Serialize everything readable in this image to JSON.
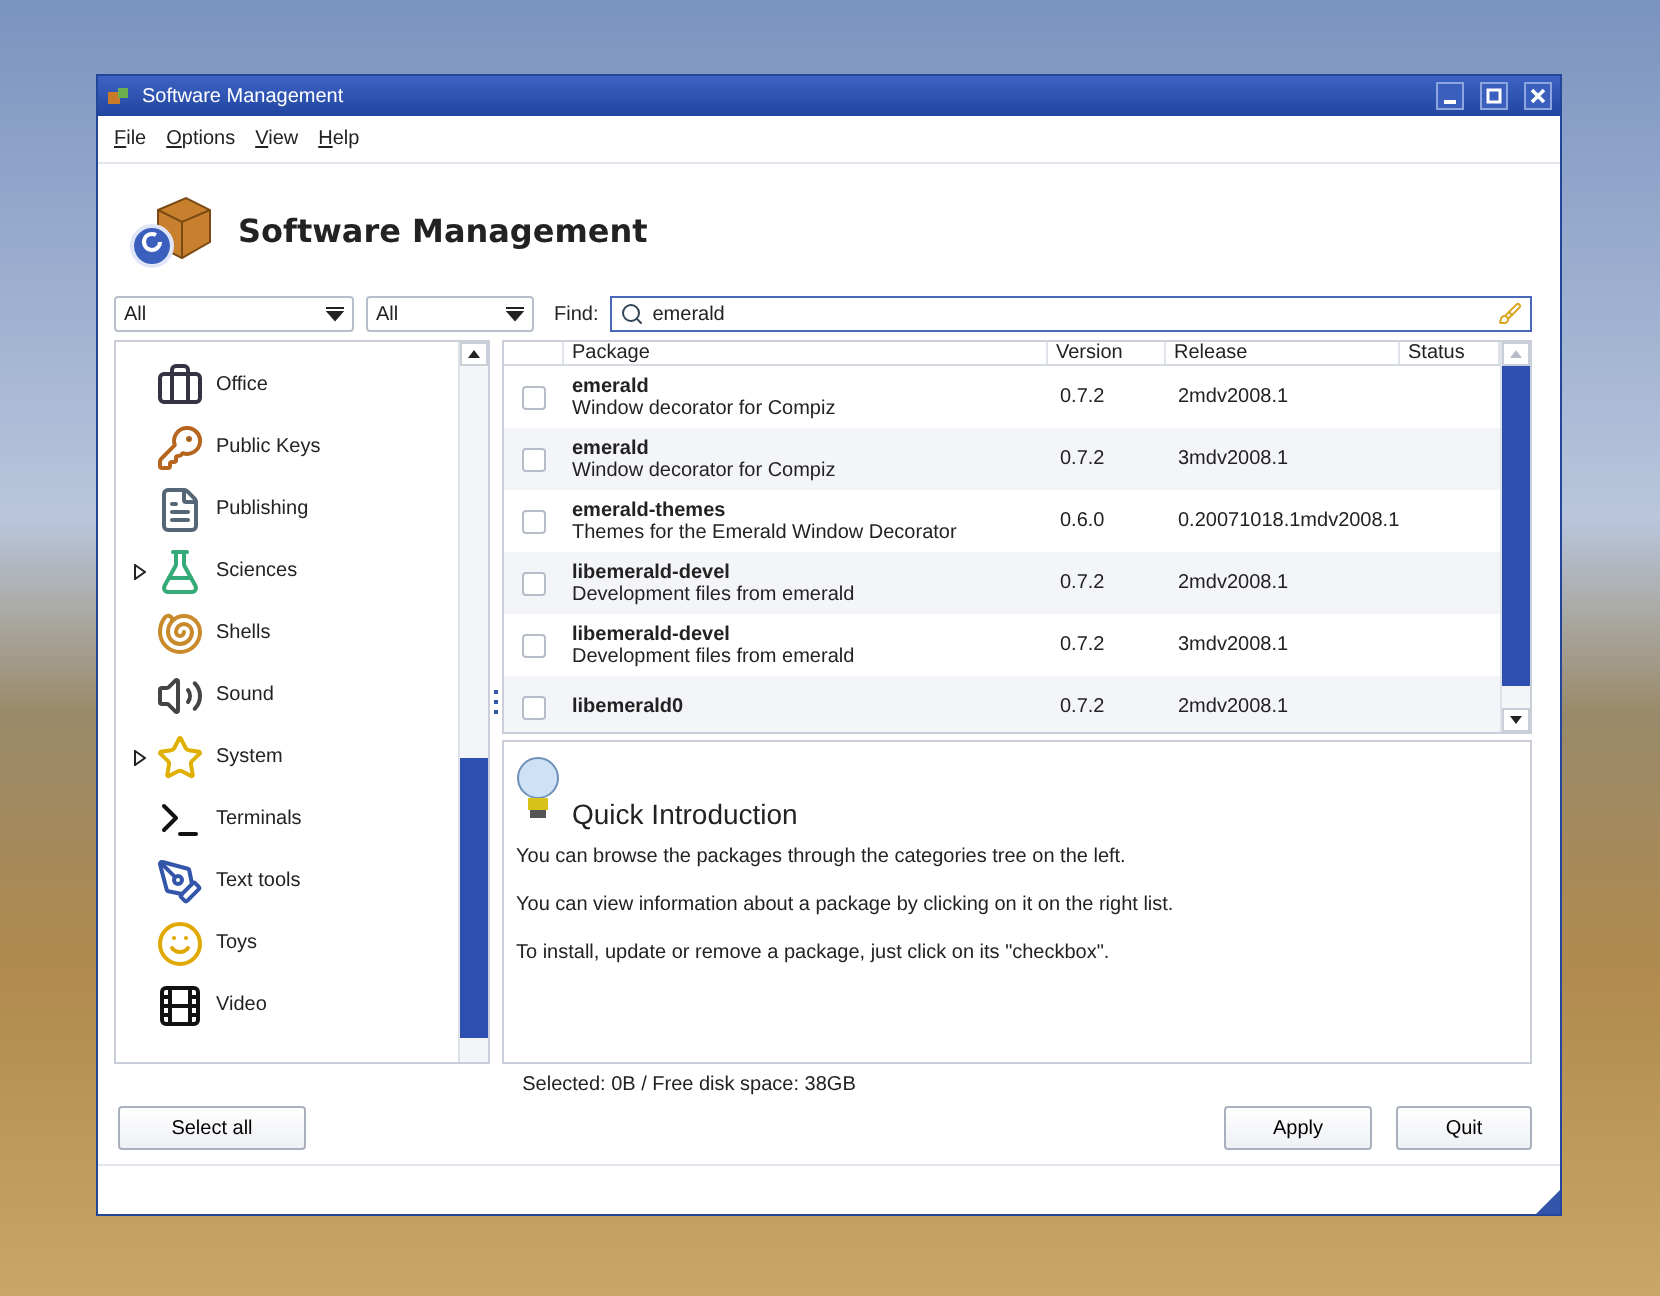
{
  "window": {
    "title": "Software Management"
  },
  "menu": [
    "File",
    "Options",
    "View",
    "Help"
  ],
  "header": {
    "title": "Software Management"
  },
  "filters": [
    {
      "value": "All"
    },
    {
      "value": "All"
    }
  ],
  "search": {
    "label": "Find:",
    "value": "emerald"
  },
  "categories": [
    {
      "label": "Office"
    },
    {
      "label": "Public Keys"
    },
    {
      "label": "Publishing"
    },
    {
      "label": "Sciences",
      "expanded": false
    },
    {
      "label": "Shells"
    },
    {
      "label": "Sound"
    },
    {
      "label": "System",
      "expanded": false
    },
    {
      "label": "Terminals"
    },
    {
      "label": "Text tools"
    },
    {
      "label": "Toys"
    },
    {
      "label": "Video"
    }
  ],
  "table": {
    "columns": [
      "Package",
      "Version",
      "Release",
      "Status"
    ],
    "rows": [
      {
        "checked": false,
        "name": "emerald",
        "description": "Window decorator for Compiz",
        "version": "0.7.2",
        "release": "2mdv2008.1"
      },
      {
        "checked": false,
        "name": "emerald",
        "description": "Window decorator for Compiz",
        "version": "0.7.2",
        "release": "3mdv2008.1"
      },
      {
        "checked": false,
        "name": "emerald-themes",
        "description": "Themes for the Emerald Window Decorator",
        "version": "0.6.0",
        "release": "0.20071018.1mdv2008.1"
      },
      {
        "checked": false,
        "name": "libemerald-devel",
        "description": "Development files from emerald",
        "version": "0.7.2",
        "release": "2mdv2008.1"
      },
      {
        "checked": false,
        "name": "libemerald-devel",
        "description": "Development files from emerald",
        "version": "0.7.2",
        "release": "3mdv2008.1"
      },
      {
        "checked": false,
        "name": "libemerald0",
        "version": "0.7.2",
        "release": "2mdv2008.1"
      }
    ]
  },
  "info": {
    "title": "Quick Introduction",
    "paragraphs": [
      "You can browse the packages through the categories tree on the left.",
      "You can view information about a package by clicking on it on the right list.",
      "To install, update or remove a package, just click on its \"checkbox\"."
    ]
  },
  "status": "Selected: 0B / Free disk space: 38GB",
  "buttons": {
    "left": "Select all",
    "right": [
      "Apply",
      "Quit"
    ]
  }
}
